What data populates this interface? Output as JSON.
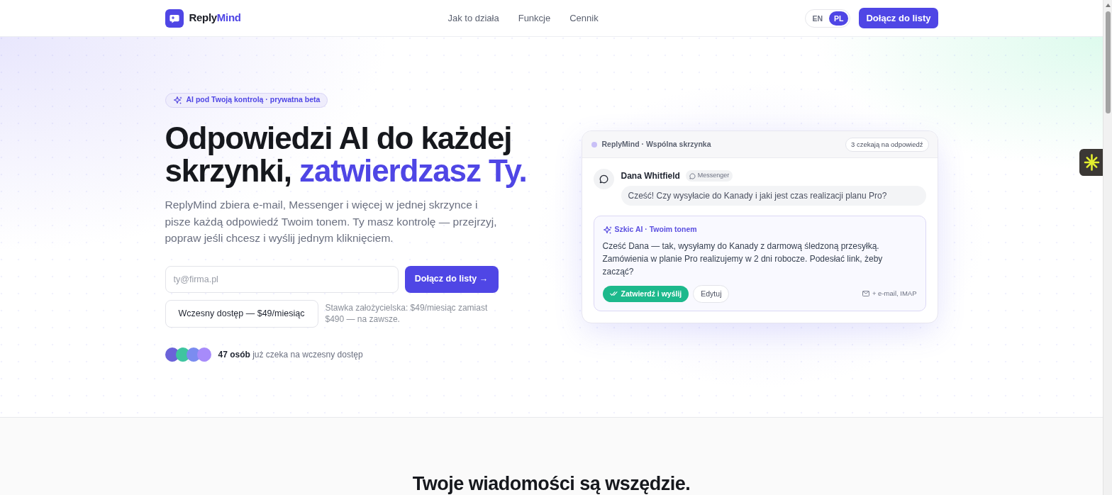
{
  "navbar": {
    "brand": {
      "name_start": "Reply",
      "name_accent": "Mind"
    },
    "links": [
      "Jak to działa",
      "Funkcje",
      "Cennik"
    ],
    "languages": [
      {
        "label": "EN",
        "selected": false
      },
      {
        "label": "PL",
        "selected": true
      }
    ],
    "cta": "Dołącz do listy"
  },
  "hero": {
    "badge": "AI pod Twoją kontrolą · prywatna beta",
    "heading": {
      "text": "Odpowiedzi AI do każdej skrzynki,",
      "accent": "zatwierdzasz Ty."
    },
    "lead": "ReplyMind zbiera e-mail, Messenger i więcej w jednej skrzynce i pisze każdą odpowiedź Twoim tonem. Ty masz kontrolę — przejrzyj, popraw jeśli chcesz i wyślij jednym kliknięciem.",
    "signup": {
      "email": {
        "placeholder": "ty@firma.pl"
      },
      "submit": "Dołącz do listy →"
    },
    "offer": {
      "button": "Wczesny dostęp — $49/miesiąc",
      "note": "Stawka założycielska: $49/miesiąc zamiast $490 — na zawsze."
    },
    "waitlist": {
      "avatars": [
        {
          "color": "#6b63d9"
        },
        {
          "color": "#3fc5a0"
        },
        {
          "color": "#7b8cf0"
        },
        {
          "color": "#a78bfa"
        }
      ],
      "text": "**47 osób** już czeka na wczesny dostęp"
    }
  },
  "inbox_card": {
    "title": "ReplyMind · Wspólna skrzynka",
    "pending": "3 czekają na odpowiedź",
    "message": {
      "sender": "Dana Whitfield",
      "channel": "Messenger",
      "text": "Cześć! Czy wysyłacie do Kanady i jaki jest czas realizacji planu Pro?"
    },
    "draft": {
      "label": "Szkic AI · Twoim tonem",
      "text": "Cześć Dana — tak, wysyłamy do Kanady z darmową śledzoną przesyłką. Zamówienia w planie Pro realizujemy w 2 dni robocze. Podesłać link, żeby zacząć?",
      "approve": "Zatwierdź i wyślij",
      "edit": "Edytuj",
      "channels": "+ e-mail, IMAP"
    }
  },
  "next_section": {
    "heading": "Twoje wiadomości są wszędzie."
  }
}
